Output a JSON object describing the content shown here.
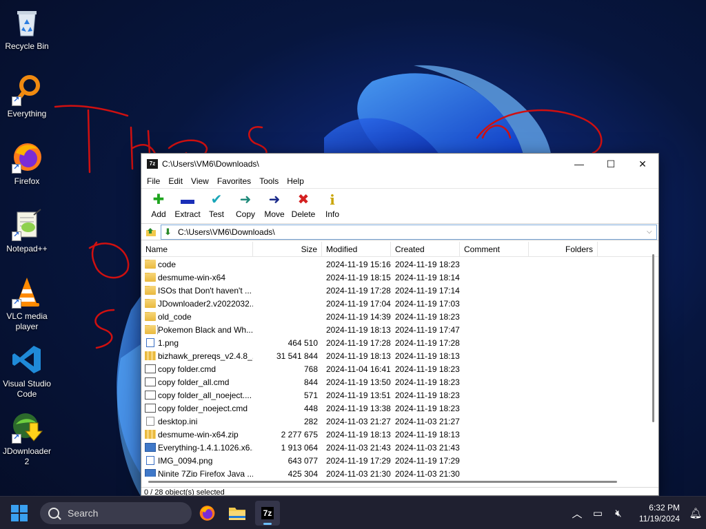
{
  "desktop": {
    "icons": [
      {
        "label": "Recycle Bin",
        "icon": "recycle-bin-icon"
      },
      {
        "label": "Everything",
        "icon": "everything-search-icon"
      },
      {
        "label": "Firefox",
        "icon": "firefox-icon"
      },
      {
        "label": "Notepad++",
        "icon": "notepad-plus-plus-icon"
      },
      {
        "label": "VLC media player",
        "icon": "vlc-icon"
      },
      {
        "label": "Visual Studio Code",
        "icon": "vscode-icon"
      },
      {
        "label": "JDownloader 2",
        "icon": "jdownloader-icon"
      }
    ]
  },
  "window": {
    "title": "C:\\Users\\VM6\\Downloads\\",
    "app_icon_text": "7z",
    "controls": {
      "minimize": "—",
      "maximize": "☐",
      "close": "✕"
    }
  },
  "menu": [
    "File",
    "Edit",
    "View",
    "Favorites",
    "Tools",
    "Help"
  ],
  "toolbar": [
    {
      "label": "Add",
      "icon": "add-icon",
      "glyph": "✚",
      "color": "#1fa51f"
    },
    {
      "label": "Extract",
      "icon": "extract-icon",
      "glyph": "▬",
      "color": "#1a2fb8"
    },
    {
      "label": "Test",
      "icon": "test-icon",
      "glyph": "✔",
      "color": "#1aa6b8"
    },
    {
      "label": "Copy",
      "icon": "copy-icon",
      "glyph": "➜",
      "color": "#1f8a7a"
    },
    {
      "label": "Move",
      "icon": "move-icon",
      "glyph": "➜",
      "color": "#1a2a8a"
    },
    {
      "label": "Delete",
      "icon": "delete-icon",
      "glyph": "✖",
      "color": "#d42020"
    },
    {
      "label": "Info",
      "icon": "info-icon",
      "glyph": "i",
      "color": "#c9a400"
    }
  ],
  "address": {
    "path": "C:\\Users\\VM6\\Downloads\\"
  },
  "columns": [
    "Name",
    "Size",
    "Modified",
    "Created",
    "Comment",
    "Folders"
  ],
  "files": [
    {
      "name": "code",
      "size": "",
      "modified": "2024-11-19 15:16",
      "created": "2024-11-19 18:23",
      "type": "folder"
    },
    {
      "name": "desmume-win-x64",
      "size": "",
      "modified": "2024-11-19 18:15",
      "created": "2024-11-19 18:14",
      "type": "folder"
    },
    {
      "name": "ISOs that Don't haven't ...",
      "size": "",
      "modified": "2024-11-19 17:28",
      "created": "2024-11-19 17:14",
      "type": "folder"
    },
    {
      "name": "JDownloader2.v2022032...",
      "size": "",
      "modified": "2024-11-19 17:04",
      "created": "2024-11-19 17:03",
      "type": "folder"
    },
    {
      "name": "old_code",
      "size": "",
      "modified": "2024-11-19 14:39",
      "created": "2024-11-19 18:23",
      "type": "folder"
    },
    {
      "name": "Pokemon Black and Wh...",
      "size": "",
      "modified": "2024-11-19 18:13",
      "created": "2024-11-19 17:47",
      "type": "folder",
      "selected": true
    },
    {
      "name": "1.png",
      "size": "464 510",
      "modified": "2024-11-19 17:28",
      "created": "2024-11-19 17:28",
      "type": "image"
    },
    {
      "name": "bizhawk_prereqs_v2.4.8_...",
      "size": "31 541 844",
      "modified": "2024-11-19 18:13",
      "created": "2024-11-19 18:13",
      "type": "zip"
    },
    {
      "name": "copy folder.cmd",
      "size": "768",
      "modified": "2024-11-04 16:41",
      "created": "2024-11-19 18:23",
      "type": "cmd"
    },
    {
      "name": "copy folder_all.cmd",
      "size": "844",
      "modified": "2024-11-19 13:50",
      "created": "2024-11-19 18:23",
      "type": "cmd"
    },
    {
      "name": "copy folder_all_noeject....",
      "size": "571",
      "modified": "2024-11-19 13:51",
      "created": "2024-11-19 18:23",
      "type": "cmd"
    },
    {
      "name": "copy folder_noeject.cmd",
      "size": "448",
      "modified": "2024-11-19 13:38",
      "created": "2024-11-19 18:23",
      "type": "cmd"
    },
    {
      "name": "desktop.ini",
      "size": "282",
      "modified": "2024-11-03 21:27",
      "created": "2024-11-03 21:27",
      "type": "file"
    },
    {
      "name": "desmume-win-x64.zip",
      "size": "2 277 675",
      "modified": "2024-11-19 18:13",
      "created": "2024-11-19 18:13",
      "type": "zip"
    },
    {
      "name": "Everything-1.4.1.1026.x6...",
      "size": "1 913 064",
      "modified": "2024-11-03 21:43",
      "created": "2024-11-03 21:43",
      "type": "exe"
    },
    {
      "name": "IMG_0094.png",
      "size": "643 077",
      "modified": "2024-11-19 17:29",
      "created": "2024-11-19 17:29",
      "type": "image"
    },
    {
      "name": "Ninite 7Zip Firefox Java ...",
      "size": "425 304",
      "modified": "2024-11-03 21:30",
      "created": "2024-11-03 21:30",
      "type": "exe"
    }
  ],
  "status": {
    "text": "0 / 28 object(s) selected"
  },
  "taskbar": {
    "search_placeholder": "Search",
    "apps": [
      {
        "name": "firefox",
        "icon": "firefox-icon"
      },
      {
        "name": "file-explorer",
        "icon": "folder-icon"
      },
      {
        "name": "7zip",
        "icon": "7zip-icon",
        "text": "7z",
        "active": true
      }
    ],
    "time": "6:32 PM",
    "date": "11/19/2024"
  },
  "colors": {
    "accent": "#3aa0f0",
    "scribble": "#d01010",
    "taskbar": "#1f2030"
  }
}
